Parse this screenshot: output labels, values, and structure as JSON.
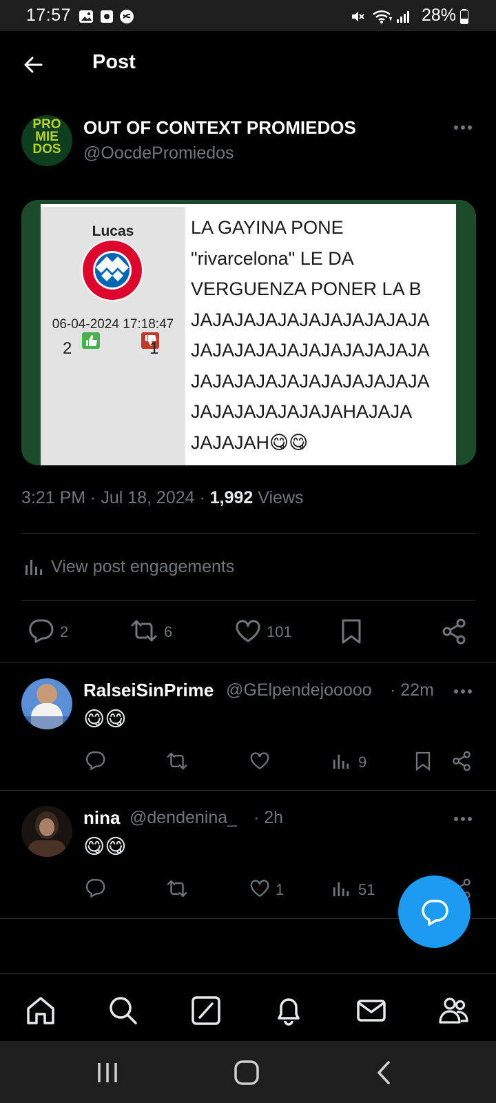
{
  "status_bar": {
    "time": "17:57",
    "battery": "28%"
  },
  "header": {
    "title": "Post"
  },
  "post": {
    "author_name": "OUT OF CONTEXT PROMIEDOS",
    "author_handle": "@OocdePromiedos",
    "avatar_text": [
      "PRO",
      "MIE",
      "DOS"
    ],
    "media": {
      "user": "Lucas",
      "date": "06-04-2024 17:18:47",
      "likes": "2",
      "dislikes": "1",
      "text": "LA GAYINA PONE\n\"rivarcelona\" LE DA\nVERGUENZA PONER LA B\nJAJAJAJAJAJAJAJAJAJAJA\nJAJAJAJAJAJAJAJAJAJAJA\nJAJAJAJAJAJAJAJAJAJAJA\nJAJAJAJAJAJAJAHAJAJA\nJAJAJAH😋😋"
    },
    "time": "3:21 PM",
    "date": "Jul 18, 2024",
    "views_count": "1,992",
    "views_label": "Views",
    "engagements_label": "View post engagements",
    "replies": "2",
    "reposts": "6",
    "likes": "101"
  },
  "replies": [
    {
      "name": "RalseiSinPrime",
      "handle": "@GElpendejooooo",
      "time": "· 22m",
      "content": "😋😋",
      "likes": "",
      "views": "9"
    },
    {
      "name": "nina",
      "handle": "@dendenina_",
      "time": "· 2h",
      "content": "😋😋",
      "likes": "1",
      "views": "51"
    }
  ],
  "colors": {
    "accent": "#1d9bf0",
    "muted": "#71767b",
    "divider": "#2f3336"
  }
}
